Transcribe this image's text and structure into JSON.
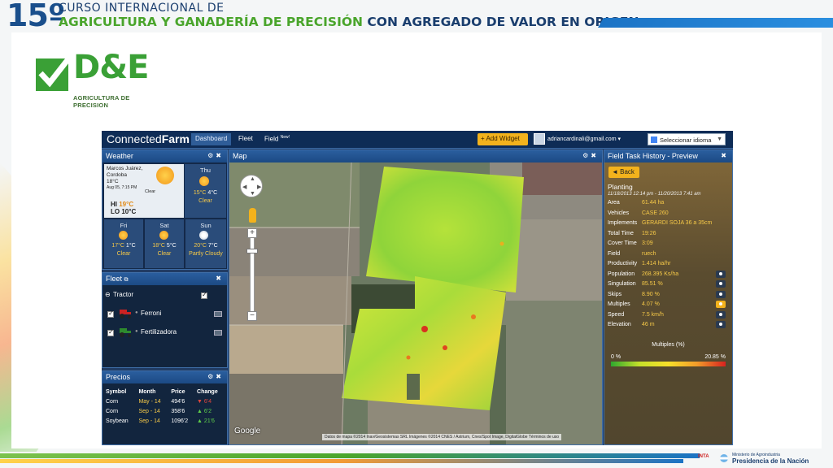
{
  "slide": {
    "number": "15º",
    "line1": "CURSO INTERNACIONAL DE",
    "line2_green": "AGRICULTURA Y GANADERÍA DE PRECISIÓN",
    "line2_blue": "CON AGREGADO DE VALOR EN ORIGEN",
    "logo_text": "D&E",
    "logo_sub": "AGRICULTURA DE PRECISION",
    "footer_inta": "INTA",
    "footer_ministry_1": "Ministerio de Agroindustria",
    "footer_ministry_2": "Presidencia de la Nación"
  },
  "topbar": {
    "brand_a": "Connected",
    "brand_b": "Farm",
    "tabs": [
      {
        "label": "Dashboard",
        "active": true
      },
      {
        "label": "Fleet",
        "active": false
      },
      {
        "label": "Field",
        "badge": "New!",
        "active": false
      }
    ],
    "add_widget": "+ Add Widget",
    "user_email": "adriancardinali@gmail.com ▾",
    "language": "Seleccionar idioma",
    "language_arrow": "▼"
  },
  "weather": {
    "title": "Weather",
    "today": {
      "location": "Marcos Juárez, Cordoba",
      "temp": "18°C",
      "date": "Aug 05, 7:15 PM",
      "condition": "Clear",
      "hi_label": "HI",
      "hi": "19°C",
      "lo_label": "LO",
      "lo": "10°C"
    },
    "forecast": [
      {
        "day": "Thu",
        "hi": "15°C",
        "lo": "4°C",
        "cond": "Clear"
      },
      {
        "day": "Fri",
        "hi": "17°C",
        "lo": "1°C",
        "cond": "Clear"
      },
      {
        "day": "Sat",
        "hi": "18°C",
        "lo": "5°C",
        "cond": "Clear"
      },
      {
        "day": "Sun",
        "hi": "20°C",
        "lo": "7°C",
        "cond": "Partly Cloudy"
      }
    ]
  },
  "fleet": {
    "title": "Fleet",
    "group": "Tractor",
    "items": [
      {
        "name": "Ferroni",
        "color": "#cc2222"
      },
      {
        "name": "Fertilizadora",
        "color": "#2e8b2e"
      }
    ]
  },
  "precios": {
    "title": "Precios",
    "headers": [
      "Symbol",
      "Month",
      "Price",
      "Change"
    ],
    "rows": [
      {
        "symbol": "Corn",
        "month": "May - 14",
        "price": "494'6",
        "change": "▼ 6'4",
        "dir": "down"
      },
      {
        "symbol": "Corn",
        "month": "Sep - 14",
        "price": "358'6",
        "change": "▲ 6'2",
        "dir": "up"
      },
      {
        "symbol": "Soybean",
        "month": "Sep - 14",
        "price": "1096'2",
        "change": "▲ 21'6",
        "dir": "up"
      }
    ]
  },
  "map": {
    "title": "Map",
    "google": "Google",
    "attribution": "Datos de mapa ©2014 Inav/Geosistemas SRL Imágenes ©2014 CNES / Astrium, Cnes/Spot Image, DigitalGlobe   Términos de uso"
  },
  "task": {
    "title": "Field Task History - Preview",
    "back": "◄ Back",
    "task_name": "Planting",
    "date_range": "11/18/2013 12:14 pm - 11/20/2013 7:41 am",
    "rows": [
      {
        "label": "Area",
        "value": "61.44 ha",
        "eye": false
      },
      {
        "label": "Vehicles",
        "value": "CASE 260",
        "eye": false
      },
      {
        "label": "Implements",
        "value": "GERARDI SOJA 36 a 35cm",
        "eye": false
      },
      {
        "label": "Total Time",
        "value": "19:26",
        "eye": false
      },
      {
        "label": "Cover Time",
        "value": "3:09",
        "eye": false
      },
      {
        "label": "Field",
        "value": "ruech",
        "eye": false
      },
      {
        "label": "Productivity",
        "value": "1.414 ha/hr",
        "eye": false
      },
      {
        "label": "Population",
        "value": "268.395 Ks/ha",
        "eye": true
      },
      {
        "label": "Singulation",
        "value": "85.51 %",
        "eye": true
      },
      {
        "label": "Skips",
        "value": "8.90 %",
        "eye": true
      },
      {
        "label": "Multiples",
        "value": "4.07 %",
        "eye": true,
        "active": true
      },
      {
        "label": "Speed",
        "value": "7.5 km/h",
        "eye": true
      },
      {
        "label": "Elevation",
        "value": "46 m",
        "eye": true
      }
    ],
    "legend_title": "Multiples (%)",
    "legend_min": "0 %",
    "legend_max": "20.85 %"
  }
}
